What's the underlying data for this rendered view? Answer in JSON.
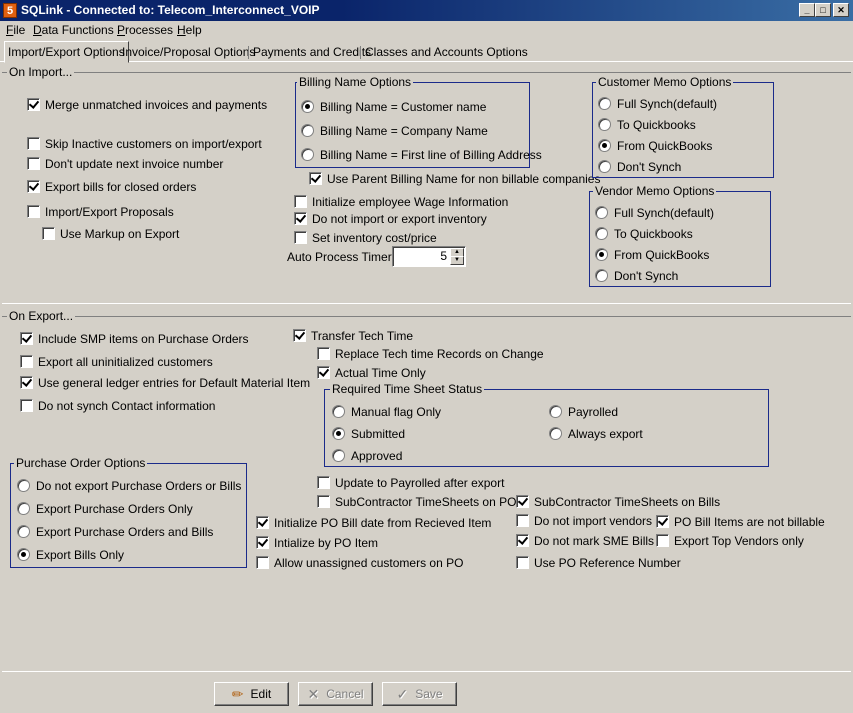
{
  "window": {
    "app_icon": "5",
    "title": "SQLink - Connected to: Telecom_Interconnect_VOIP",
    "minimize": "_",
    "maximize": "□",
    "close": "✕"
  },
  "menu": [
    {
      "u": "F",
      "rest": "ile"
    },
    {
      "u": "D",
      "rest": "ata Functions"
    },
    {
      "u": "P",
      "rest": "rocesses"
    },
    {
      "u": "H",
      "rest": "elp"
    }
  ],
  "tabs": [
    "Import/Export Options",
    "Invoice/Proposal Options",
    "Payments and Credits",
    "Classes and Accounts Options"
  ],
  "import": {
    "legend": "On Import...",
    "checks": {
      "merge": {
        "label": "Merge unmatched invoices and payments",
        "checked": true
      },
      "skip_inactive": {
        "label": "Skip Inactive customers on import/export",
        "checked": false
      },
      "no_update_invoice": {
        "label": "Don't update next invoice number",
        "checked": false
      },
      "export_bills": {
        "label": "Export bills for closed orders",
        "checked": true
      },
      "proposals": {
        "label": "Import/Export Proposals",
        "checked": false
      },
      "markup": {
        "label": "Use Markup on Export",
        "checked": false
      },
      "parent_billing": {
        "label": "Use Parent Billing Name for non billable companies",
        "checked": true
      },
      "wage": {
        "label": "Initialize employee Wage Information",
        "checked": false
      },
      "no_inventory": {
        "label": "Do not import or export inventory",
        "checked": true
      },
      "cost_price": {
        "label": "Set inventory cost/price",
        "checked": false
      }
    },
    "billing_name": {
      "legend": "Billing Name Options",
      "options": [
        {
          "label": "Billing Name = Customer name",
          "selected": true
        },
        {
          "label": "Billing Name = Company Name",
          "selected": false
        },
        {
          "label": "Billing Name = First line of Billing Address",
          "selected": false
        }
      ]
    },
    "customer_memo": {
      "legend": "Customer Memo Options",
      "options": [
        {
          "label": "Full Synch(default)",
          "selected": false
        },
        {
          "label": "To Quickbooks",
          "selected": false
        },
        {
          "label": "From QuickBooks",
          "selected": true
        },
        {
          "label": "Don't Synch",
          "selected": false
        }
      ]
    },
    "vendor_memo": {
      "legend": "Vendor Memo Options",
      "options": [
        {
          "label": "Full Synch(default)",
          "selected": false
        },
        {
          "label": "To Quickbooks",
          "selected": false
        },
        {
          "label": "From QuickBooks",
          "selected": true
        },
        {
          "label": "Don't Synch",
          "selected": false
        }
      ]
    },
    "timer": {
      "label": "Auto Process Timer",
      "value": "5",
      "up": "▲",
      "down": "▼"
    }
  },
  "export": {
    "legend": "On Export...",
    "checks": {
      "smp": {
        "label": "Include SMP items on Purchase Orders",
        "checked": true
      },
      "uninit": {
        "label": "Export all uninitialized customers",
        "checked": false
      },
      "gl": {
        "label": "Use general ledger entries for Default Material Item",
        "checked": true
      },
      "contact": {
        "label": "Do not synch Contact information",
        "checked": false
      },
      "tech_time": {
        "label": "Transfer Tech Time",
        "checked": true
      },
      "replace_tech": {
        "label": "Replace Tech time Records on Change",
        "checked": false
      },
      "actual_time": {
        "label": "Actual Time Only",
        "checked": true
      },
      "payrolled": {
        "label": "Update to Payrolled after export",
        "checked": false
      },
      "sub_po": {
        "label": "SubContractor TimeSheets on PO",
        "checked": false
      },
      "sub_bills": {
        "label": "SubContractor TimeSheets on Bills",
        "checked": true
      },
      "init_po_date": {
        "label": "Initialize PO Bill date from Recieved Item",
        "checked": true
      },
      "no_vendors": {
        "label": "Do not import vendors",
        "checked": false
      },
      "po_bill_items": {
        "label": "PO Bill Items are not billable",
        "checked": true
      },
      "init_po_item": {
        "label": "Intialize by PO Item",
        "checked": true
      },
      "no_sme": {
        "label": "Do not mark SME Bills",
        "checked": true
      },
      "top_vendors": {
        "label": "Export Top Vendors only",
        "checked": false
      },
      "unassigned": {
        "label": "Allow unassigned customers on PO",
        "checked": false
      },
      "po_ref": {
        "label": "Use PO Reference Number",
        "checked": false
      }
    },
    "timesheet_status": {
      "legend": "Required Time Sheet Status",
      "options": [
        {
          "label": "Manual flag Only",
          "selected": false
        },
        {
          "label": "Submitted",
          "selected": true
        },
        {
          "label": "Approved",
          "selected": false
        },
        {
          "label": "Payrolled",
          "selected": false
        },
        {
          "label": "Always export",
          "selected": false
        }
      ]
    },
    "po_options": {
      "legend": "Purchase Order Options",
      "options": [
        {
          "label": "Do not export Purchase Orders or Bills",
          "selected": false
        },
        {
          "label": "Export Purchase Orders Only",
          "selected": false
        },
        {
          "label": "Export Purchase Orders and Bills",
          "selected": false
        },
        {
          "label": "Export Bills Only",
          "selected": true
        }
      ]
    }
  },
  "buttons": {
    "edit": {
      "label": "Edit",
      "icon": "pencil-icon",
      "glyph": "✏"
    },
    "cancel": {
      "label": "Cancel",
      "icon": "x-icon",
      "glyph": "✕"
    },
    "save": {
      "label": "Save",
      "icon": "checkmark-icon",
      "glyph": "✓"
    }
  }
}
